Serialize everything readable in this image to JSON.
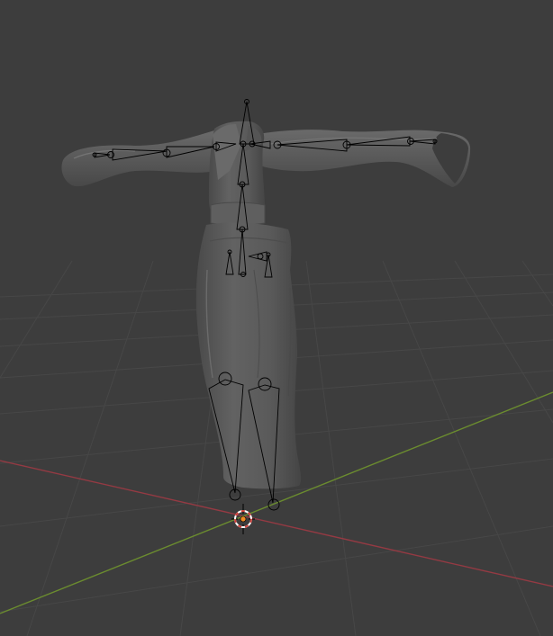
{
  "viewport": {
    "background_color": "#3d3d3d",
    "grid_color": "#474747",
    "x_axis_color": "#943a43",
    "y_axis_color": "#6b8c2f",
    "mesh_color": "#5c5c5c",
    "armature_color": "#000000",
    "origin_color": "#f08a24"
  },
  "objects": [
    {
      "name": "dress-mesh-icon",
      "kind": "mesh"
    },
    {
      "name": "armature-icon",
      "kind": "armature"
    },
    {
      "name": "3d-cursor-icon",
      "kind": "cursor"
    }
  ]
}
